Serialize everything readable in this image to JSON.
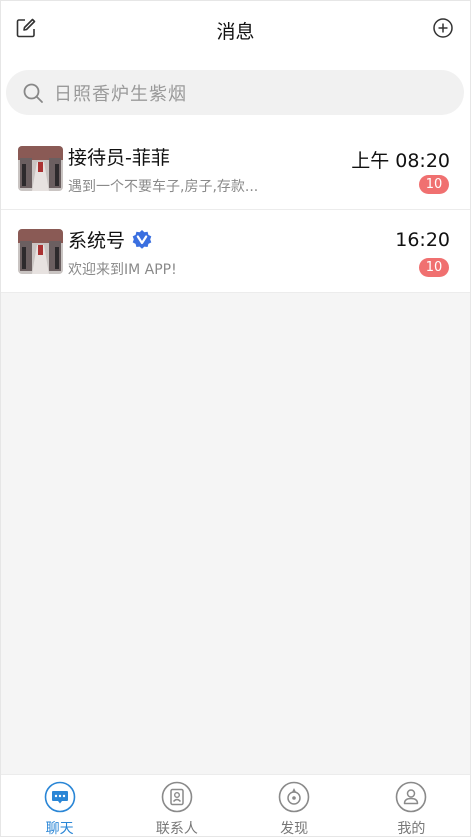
{
  "header": {
    "title": "消息",
    "edit_icon": "edit-icon",
    "add_icon": "plus-circle-icon"
  },
  "search": {
    "placeholder": "日照香炉生紫烟",
    "icon": "search-icon"
  },
  "chats": [
    {
      "name": "接待员-菲菲",
      "preview": "遇到一个不要车子,房子,存款...",
      "time": "上午 08:20",
      "unread": "10",
      "verified": false
    },
    {
      "name": "系统号",
      "preview": "欢迎来到IM APP!",
      "time": "16:20",
      "unread": "10",
      "verified": true
    }
  ],
  "tabbar": {
    "tabs": [
      {
        "label": "聊天",
        "icon": "chat-icon",
        "active": true
      },
      {
        "label": "联系人",
        "icon": "contacts-icon",
        "active": false
      },
      {
        "label": "发现",
        "icon": "compass-icon",
        "active": false
      },
      {
        "label": "我的",
        "icon": "profile-icon",
        "active": false
      }
    ]
  },
  "colors": {
    "accent": "#2a86d6",
    "badge": "#f07070",
    "verified": "#3a6fe0",
    "background": "#f5f5f5"
  }
}
